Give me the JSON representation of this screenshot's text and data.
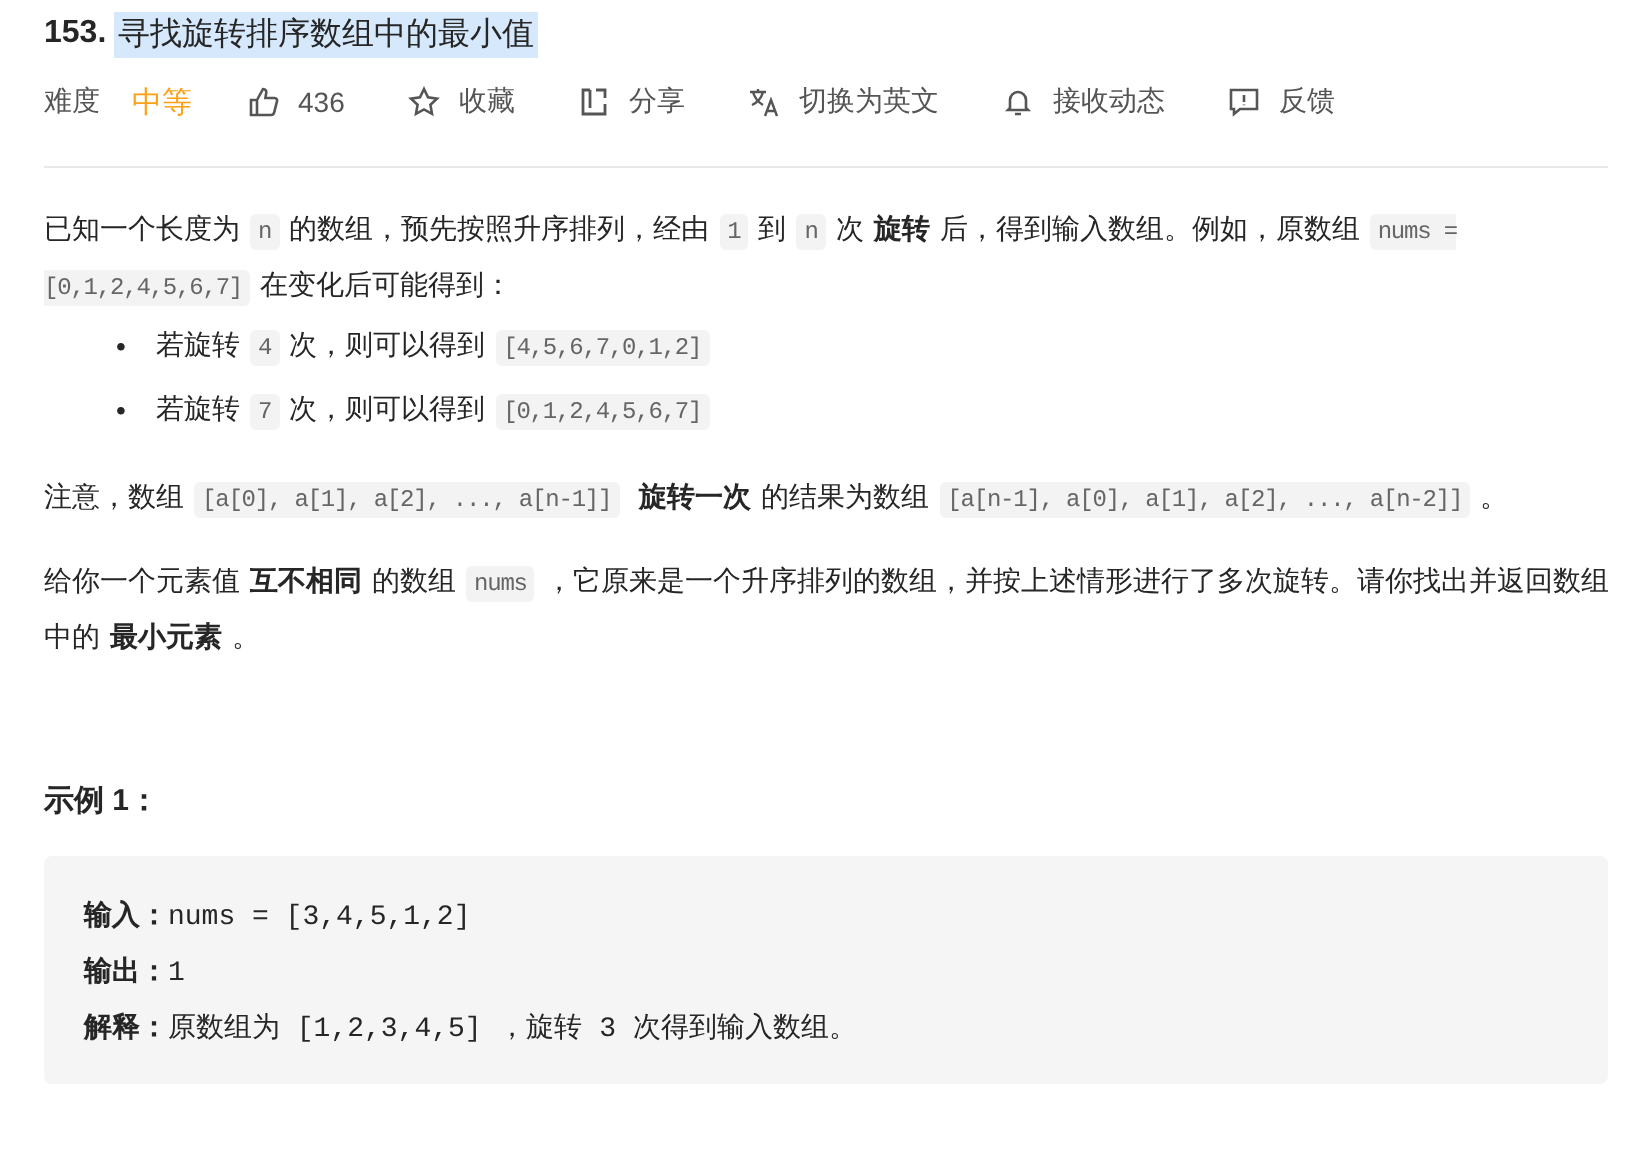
{
  "title": {
    "number": "153.",
    "text": "寻找旋转排序数组中的最小值",
    "highlighted": true
  },
  "meta": {
    "difficulty_label": "难度",
    "difficulty": "中等",
    "actions": [
      {
        "kind": "like",
        "label": "436"
      },
      {
        "kind": "star",
        "label": "收藏"
      },
      {
        "kind": "share",
        "label": "分享"
      },
      {
        "kind": "translate",
        "label": "切换为英文"
      },
      {
        "kind": "bell",
        "label": "接收动态"
      },
      {
        "kind": "feedback",
        "label": "反馈"
      }
    ]
  },
  "description": [
    [
      {
        "kind": "text",
        "text": "已知一个长度为"
      },
      {
        "kind": "code",
        "text": "n"
      },
      {
        "kind": "text",
        "text": "的数组，预先按照升序排列，经由"
      },
      {
        "kind": "code",
        "text": "1"
      },
      {
        "kind": "text",
        "text": "到"
      },
      {
        "kind": "code",
        "text": "n"
      },
      {
        "kind": "text",
        "text": "次"
      },
      {
        "kind": "bold",
        "text": "旋转"
      },
      {
        "kind": "text",
        "text": "后，得到输入数组。例如，原数组"
      },
      {
        "kind": "code",
        "text": "nums = [0,1,2,4,5,6,7]"
      },
      {
        "kind": "text",
        "text": "在变化后可能得到："
      }
    ]
  ],
  "bullets": [
    {
      "marker": "•",
      "segments": [
        {
          "kind": "text",
          "text": "若旋转"
        },
        {
          "kind": "code",
          "text": "4"
        },
        {
          "kind": "text",
          "text": "次，则可以得到"
        },
        {
          "kind": "code",
          "text": "[4,5,6,7,0,1,2]"
        }
      ]
    },
    {
      "marker": "•",
      "segments": [
        {
          "kind": "text",
          "text": "若旋转"
        },
        {
          "kind": "code",
          "text": "7"
        },
        {
          "kind": "text",
          "text": "次，则可以得到"
        },
        {
          "kind": "code",
          "text": "[0,1,2,4,5,6,7]"
        }
      ]
    }
  ],
  "paragraphs": [
    [
      {
        "kind": "text",
        "text": "注意，数组"
      },
      {
        "kind": "code",
        "text": "[a[0], a[1], a[2], ..., a[n-1]]"
      },
      {
        "kind": "bold",
        "text": "旋转一次"
      },
      {
        "kind": "text",
        "text": "的结果为数组"
      },
      {
        "kind": "code",
        "text": "[a[n-1], a[0], a[1], a[2], ..., a[n-2]]"
      },
      {
        "kind": "text",
        "text": "。"
      }
    ],
    [
      {
        "kind": "text",
        "text": "给你一个元素值"
      },
      {
        "kind": "bold",
        "text": "互不相同"
      },
      {
        "kind": "text",
        "text": "的数组"
      },
      {
        "kind": "code",
        "text": "nums"
      },
      {
        "kind": "text",
        "text": "，它原来是一个升序排列的数组，并按上述情形进行了多次旋转。请你找出并返回数组中的"
      },
      {
        "kind": "bold",
        "text": "最小元素"
      },
      {
        "kind": "text",
        "text": "。"
      }
    ]
  ],
  "example": {
    "title": "示例 1：",
    "lines": [
      {
        "label": "输入：",
        "value": "nums = [3,4,5,1,2]"
      },
      {
        "label": "输出：",
        "value": "1"
      },
      {
        "label": "解释：",
        "value": "原数组为 [1,2,3,4,5] ，旋转 3 次得到输入数组。"
      }
    ]
  }
}
